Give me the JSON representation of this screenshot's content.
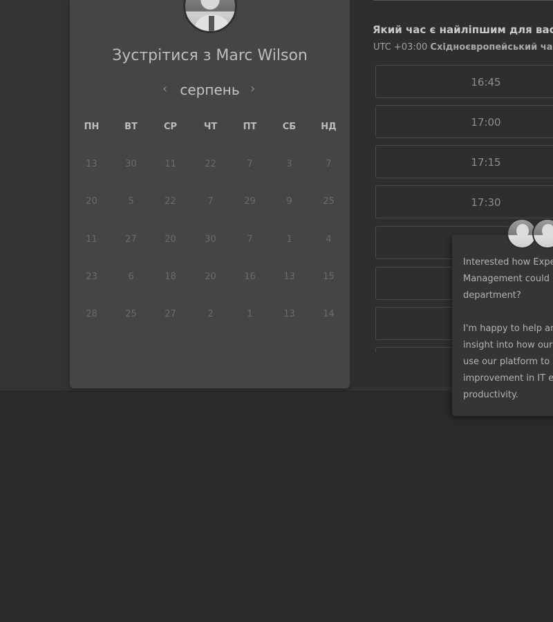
{
  "scheduler": {
    "meet_title": "Зустрітися з Marc Wilson",
    "month": "серпень",
    "prev_arrow": "‹",
    "next_arrow": "›",
    "weekdays": [
      "ПН",
      "ВТ",
      "СР",
      "ЧТ",
      "ПТ",
      "СБ",
      "НД"
    ],
    "weeks": [
      [
        "13",
        "30",
        "11",
        "22",
        "7",
        "3",
        "7"
      ],
      [
        "20",
        "5",
        "22",
        "7",
        "29",
        "9",
        "25"
      ],
      [
        "11",
        "27",
        "20",
        "30",
        "7",
        "1",
        "4"
      ],
      [
        "23",
        "6",
        "18",
        "20",
        "16",
        "13",
        "15"
      ],
      [
        "28",
        "25",
        "27",
        "2",
        "1",
        "13",
        "14"
      ]
    ]
  },
  "times": {
    "question": "Який час є найліпшим для вас?",
    "timezone_prefix": "UTC +03:00",
    "timezone_name": "Східноєвропейський час",
    "slots": [
      "16:45",
      "17:00",
      "17:15",
      "17:30",
      "",
      "",
      "",
      ""
    ]
  },
  "chat": {
    "lines": [
      "Interested how Expe",
      "Management could h",
      "department?",
      "",
      "I'm happy to help and",
      "insight into how our c",
      "use our platform to a",
      "improvement in IT en",
      "productivity."
    ]
  },
  "colors": {
    "background": "#2a2a2a",
    "calendar_panel": "#454545",
    "right_panel": "#2e2e2e",
    "slot_border": "#4a4a4a"
  }
}
